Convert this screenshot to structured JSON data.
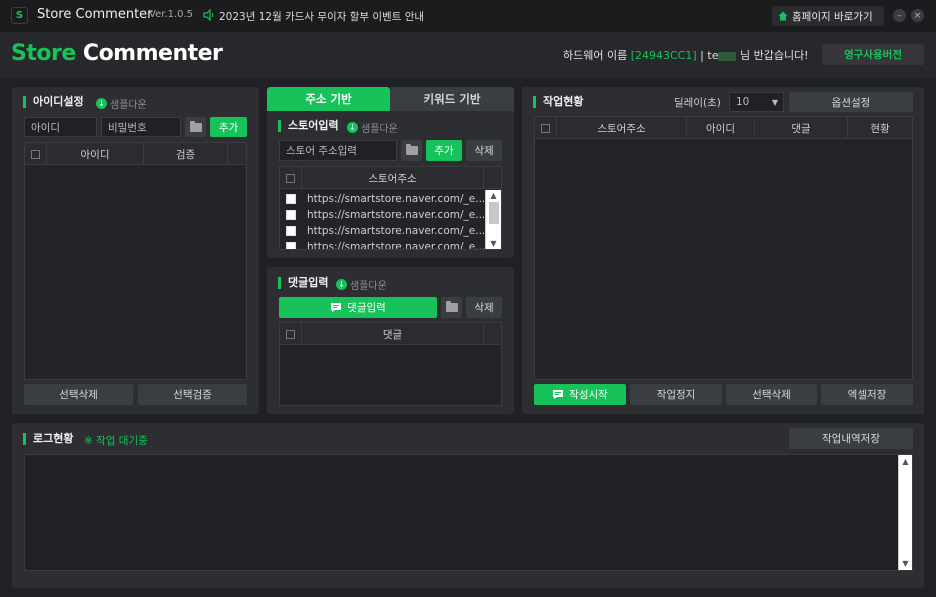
{
  "titlebar": {
    "app_icon_letter": "S",
    "app_title": "Store Commenter",
    "version": "Ver.1.0.5",
    "notice": "2023년 12월 카드사 무이자 할부 이벤트 안내",
    "home_label": "홈페이지 바로가기",
    "minimize_icon": "–",
    "close_icon": "×"
  },
  "header": {
    "logo_part1": "Store",
    "logo_part2": "Commenter",
    "hw_prefix": "하드웨어 이름",
    "hw_code": "[24943CC1]",
    "hw_separator": "|",
    "user_name": "te",
    "user_suffix": "님 반갑습니다!",
    "license_label": "영구사용버전"
  },
  "id_panel": {
    "title": "아이디설정",
    "sample_label": "샘플다운",
    "id_placeholder": "아이디",
    "pw_placeholder": "비밀번호",
    "add_label": "추가",
    "columns": [
      "아이디",
      "검증"
    ],
    "delete_selected": "선택삭제",
    "verify_selected": "선택검증"
  },
  "tabs": {
    "address": "주소 기반",
    "keyword": "키워드 기반"
  },
  "store_panel": {
    "title": "스토어입력",
    "sample_label": "샘플다운",
    "input_placeholder": "스토어 주소입력",
    "add_label": "추가",
    "delete_label": "삭제",
    "column": "스토어주소",
    "urls": [
      "https://smartstore.naver.com/_e...",
      "https://smartstore.naver.com/_e...",
      "https://smartstore.naver.com/_e...",
      "https://smartstore.naver.com/_e..."
    ]
  },
  "comment_panel": {
    "title": "댓글입력",
    "sample_label": "샘플다운",
    "input_button": "댓글입력",
    "delete_label": "삭제",
    "column": "댓글"
  },
  "work_panel": {
    "title": "작업현황",
    "delay_label": "딜레이(초)",
    "delay_value": "10",
    "options_label": "옵션설정",
    "columns": [
      "스토어주소",
      "아이디",
      "댓글",
      "현황"
    ],
    "start_label": "작성시작",
    "stop_label": "작업정지",
    "delete_selected": "선택삭제",
    "excel_save": "엑셀저장"
  },
  "log_panel": {
    "title": "로그현황",
    "status": "※ 작업 대기중",
    "save_label": "작업내역저장"
  },
  "colors": {
    "accent": "#17c25a",
    "background": "#1f2124",
    "panel": "#2c2e32"
  },
  "icons": [
    "app-icon",
    "speaker-icon",
    "home-icon",
    "download-icon",
    "folder-icon",
    "comment-icon",
    "chevron-down-icon"
  ]
}
